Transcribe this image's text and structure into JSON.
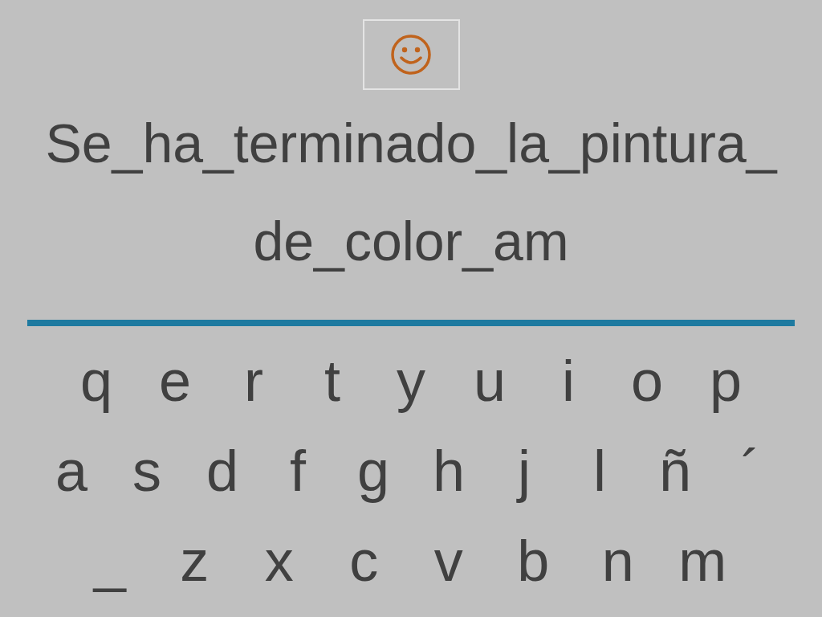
{
  "sentence": {
    "lines": [
      "Se_ha_terminado_la_pintura_",
      "de_color_am"
    ]
  },
  "keyboard": {
    "rows": [
      [
        "q",
        "e",
        "r",
        "t",
        "y",
        "u",
        "i",
        "o",
        "p"
      ],
      [
        "a",
        "s",
        "d",
        "f",
        "g",
        "h",
        "j",
        "l",
        "ñ",
        "´"
      ],
      [
        "_",
        "z",
        "x",
        "c",
        "v",
        "b",
        "n",
        "m"
      ]
    ]
  }
}
